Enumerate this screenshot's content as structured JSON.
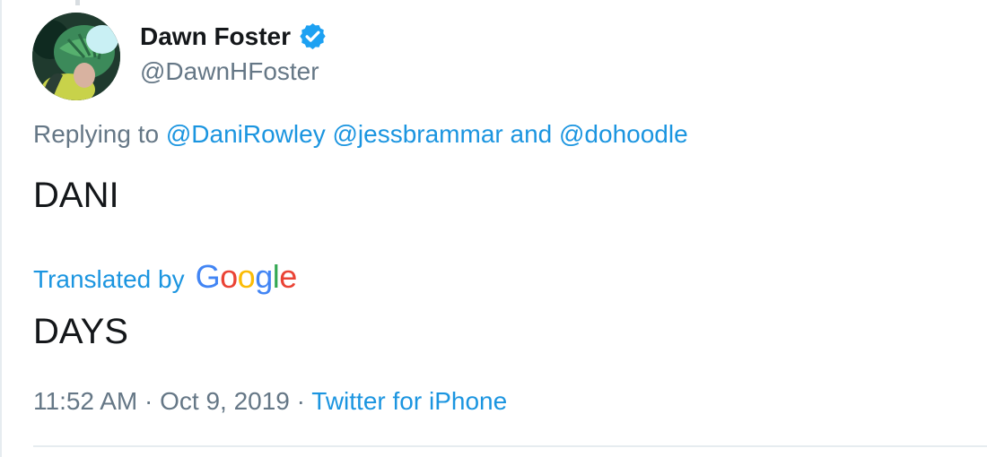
{
  "author": {
    "display_name": "Dawn Foster",
    "handle": "@DawnHFoster",
    "verified": true,
    "verified_icon": "verified-badge-icon",
    "avatar": "avatar-image"
  },
  "reply": {
    "prefix": "Replying to ",
    "users": [
      "@DaniRowley",
      "@jessbrammar",
      "@dohoodle"
    ],
    "conjunction": " and "
  },
  "tweet": {
    "text": "DANI"
  },
  "translation": {
    "label": "Translated by",
    "provider": "Google",
    "text": "DAYS"
  },
  "meta": {
    "time": "11:52 AM",
    "separator": " · ",
    "date": "Oct 9, 2019",
    "source": "Twitter for iPhone"
  },
  "colors": {
    "link": "#1b95e0",
    "muted": "#657786",
    "text": "#14171a",
    "verified": "#1da1f2",
    "google_blue": "#4285f4",
    "google_red": "#ea4335",
    "google_yellow": "#fbbc05",
    "google_green": "#34a853"
  }
}
